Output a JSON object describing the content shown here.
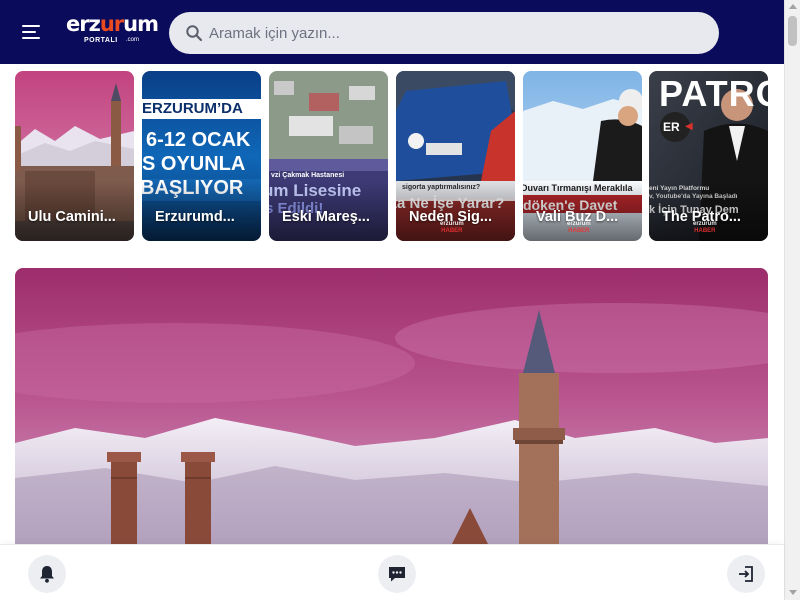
{
  "header": {
    "logo": {
      "main_a": "erz",
      "main_accent": "ur",
      "main_b": "um",
      "sub": "PORTALI",
      "domain": ".com"
    },
    "search": {
      "placeholder": "Aramak için yazın...",
      "value": ""
    }
  },
  "stories": [
    {
      "label": "Ulu Camini...",
      "overlay": ""
    },
    {
      "label": "Erzurumd...",
      "overlay": "ERZURUM'DA | 6-12 OCAK | S OYUNLA | BAŞLIYOR"
    },
    {
      "label": "Eski Mareş...",
      "overlay": "vzi Çakmak Hastanesi | um Lisesine | s Edildi!"
    },
    {
      "label": "Neden Sig...",
      "overlay": "sigorta yaptırmalısınız? | ta Ne İşe Yarar?"
    },
    {
      "label": "Vali Buz D...",
      "overlay": "Duvarı Tırmanışı Meraklıla | döken'e Davet"
    },
    {
      "label": "The Patro...",
      "overlay": "PATRON | ER | eni Yayın Platformu | v, Youtube'da Yayına Başladı | k İçin Tunay Dem"
    }
  ],
  "story_badge": {
    "top": "erzurum",
    "bottom": "HABER"
  },
  "colors": {
    "header_bg": "#0b0b5c",
    "logo_accent": "#e94a1f",
    "search_bg": "#e7e9ee",
    "hero_sky_top": "#a0306f",
    "hero_sky_bottom": "#c46fa8"
  },
  "icons": {
    "menu": "menu-icon",
    "search": "search-icon",
    "notifications": "bell-icon",
    "messages": "chat-icon",
    "login": "login-icon"
  }
}
